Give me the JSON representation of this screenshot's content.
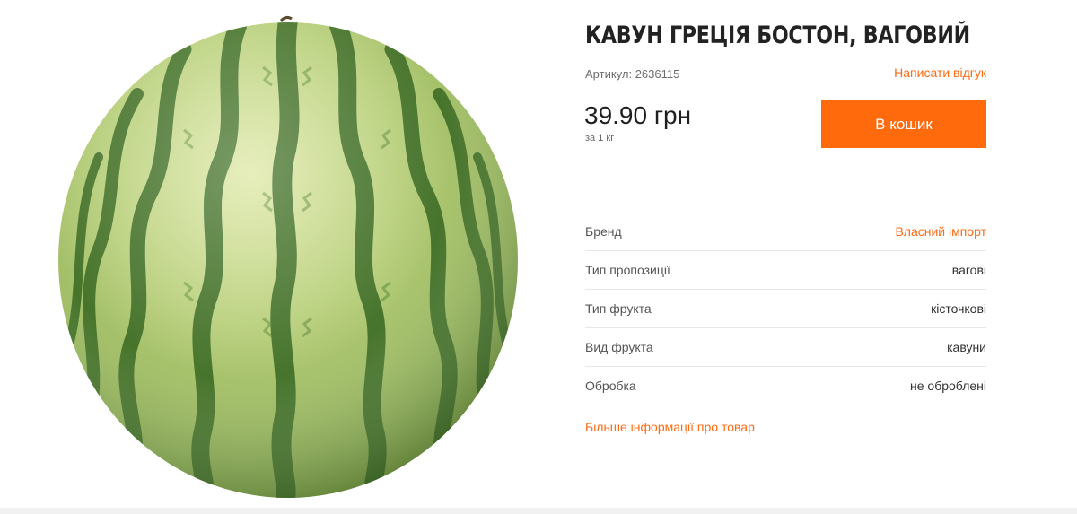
{
  "product": {
    "title": "Кавун Греція Бостон, ваговий",
    "article_label": "Артикул: 2636115",
    "review_link": "Написати відгук",
    "price": "39.90 грн",
    "price_unit": "за 1 кг",
    "cart_button": "В кошик",
    "image_icon": "watermelon-image"
  },
  "specs": [
    {
      "label": "Бренд",
      "value": "Власний імпорт",
      "is_link": true
    },
    {
      "label": "Тип пропозиції",
      "value": "вагові",
      "is_link": false
    },
    {
      "label": "Тип фрукта",
      "value": "кісточкові",
      "is_link": false
    },
    {
      "label": "Вид фрукта",
      "value": "кавуни",
      "is_link": false
    },
    {
      "label": "Обробка",
      "value": "не оброблені",
      "is_link": false
    }
  ],
  "more_info_link": "Більше інформації про товар",
  "colors": {
    "accent": "#ff6a0d",
    "link": "#ff6a13",
    "watermelon_light": "#b8d07e",
    "watermelon_dark": "#4a7a2c"
  }
}
